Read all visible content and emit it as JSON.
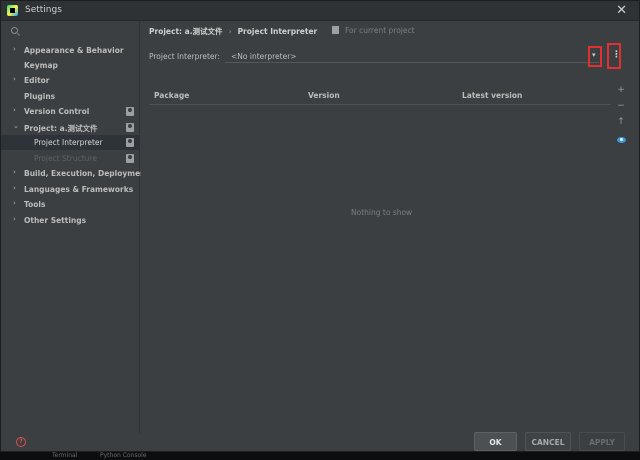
{
  "window": {
    "title": "Settings"
  },
  "sidebar": {
    "search_placeholder": "",
    "items": [
      {
        "label": "Appearance & Behavior",
        "arrow": "›"
      },
      {
        "label": "Keymap",
        "arrow": ""
      },
      {
        "label": "Editor",
        "arrow": "›"
      },
      {
        "label": "Plugins",
        "arrow": ""
      },
      {
        "label": "Version Control",
        "arrow": "›"
      },
      {
        "label": "Project: a.测试文件",
        "arrow": "⌄"
      },
      {
        "label": "Project Interpreter",
        "arrow": ""
      },
      {
        "label": "Project Structure",
        "arrow": ""
      },
      {
        "label": "Build, Execution, Deployment",
        "arrow": "›"
      },
      {
        "label": "Languages & Frameworks",
        "arrow": "›"
      },
      {
        "label": "Tools",
        "arrow": "›"
      },
      {
        "label": "Other Settings",
        "arrow": "›"
      }
    ]
  },
  "main": {
    "breadcrumb": {
      "project": "Project: a.测试文件",
      "separator": "›",
      "page": "Project Interpreter"
    },
    "for_current_project": "For current project",
    "interpreter_label": "Project Interpreter:",
    "interpreter_value": "<No interpreter>",
    "dropdown_glyph": "▾",
    "more_glyph": "⋮",
    "table": {
      "columns": [
        "Package",
        "Version",
        "Latest version"
      ],
      "empty_text": "Nothing to show"
    },
    "tools": {
      "add": "+",
      "remove": "−",
      "upgrade": "↑"
    }
  },
  "footer": {
    "help_glyph": "?",
    "ok": "OK",
    "cancel": "CANCEL",
    "apply": "APPLY"
  },
  "taskbar": {
    "items": [
      "Terminal",
      "Python Console"
    ]
  },
  "colors": {
    "highlight_border": "#e23030",
    "selected_row": "#2d3338",
    "eye": "#3d9ad8"
  }
}
